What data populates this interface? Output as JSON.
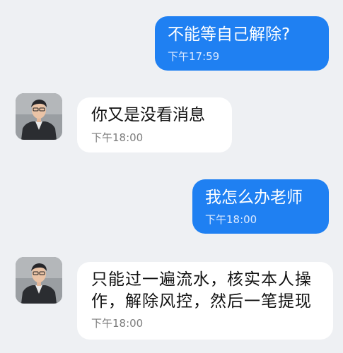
{
  "colors": {
    "outgoing_bubble": "#1f80f2",
    "incoming_bubble": "#ffffff",
    "background": "#eef0f3"
  },
  "messages": [
    {
      "side": "out",
      "text": "不能等自己解除?",
      "time": "下午17:59"
    },
    {
      "side": "in",
      "text": "你又是没看消息",
      "time": "下午18:00",
      "avatar": "person-avatar"
    },
    {
      "side": "out",
      "text": "我怎么办老师",
      "time": "下午18:00"
    },
    {
      "side": "in",
      "text": "只能过一遍流水，核实本人操\n作，解除风控，然后一笔提现",
      "time": "下午18:00",
      "avatar": "person-avatar"
    }
  ]
}
